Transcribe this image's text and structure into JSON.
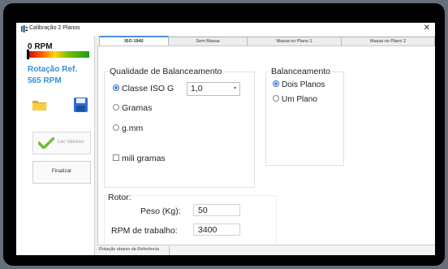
{
  "window": {
    "title": "Calibração 2 Planos",
    "close_glyph": "✕"
  },
  "sidebar": {
    "rpm_text": "0 RPM",
    "ref_label": "Rotação Ref.",
    "ref_value": "565 RPM",
    "read_button_label": "Ler Valores",
    "finish_button_label": "Finalizar",
    "icons": [
      "folder-icon",
      "save-disk-icon",
      "check-icon"
    ]
  },
  "tabs": [
    {
      "label": "ISO 1940",
      "active": true
    },
    {
      "label": "Sem Massa",
      "active": false
    },
    {
      "label": "Massa no Plano 1",
      "active": false
    },
    {
      "label": "Massa no Plano 2",
      "active": false
    }
  ],
  "quality": {
    "legend": "Qualidade de Balanceamento",
    "opt_iso": "Classe ISO G",
    "iso_value": "1,0",
    "opt_gramas": "Gramas",
    "opt_gmm": "g.mm",
    "mili_gramas": "mili gramas",
    "selected": "opt_iso"
  },
  "balance": {
    "legend": "Balanceamento",
    "opt_dois": "Dois Planos",
    "opt_um": "Um Plano",
    "selected": "opt_dois"
  },
  "rotor": {
    "legend": "Rotor:",
    "peso_label": "Peso (Kg):",
    "peso_value": "50",
    "rpm_label": "RPM de trabalho:",
    "rpm_value": "3400"
  },
  "status_bar": {
    "text": "Rotação abaixo da Referência"
  },
  "colors": {
    "accent": "#3a8fd0",
    "radio": "#2a6fcf",
    "check": "#6cbf3a",
    "folder": "#f2c12e",
    "disk": "#2d6fd1"
  }
}
